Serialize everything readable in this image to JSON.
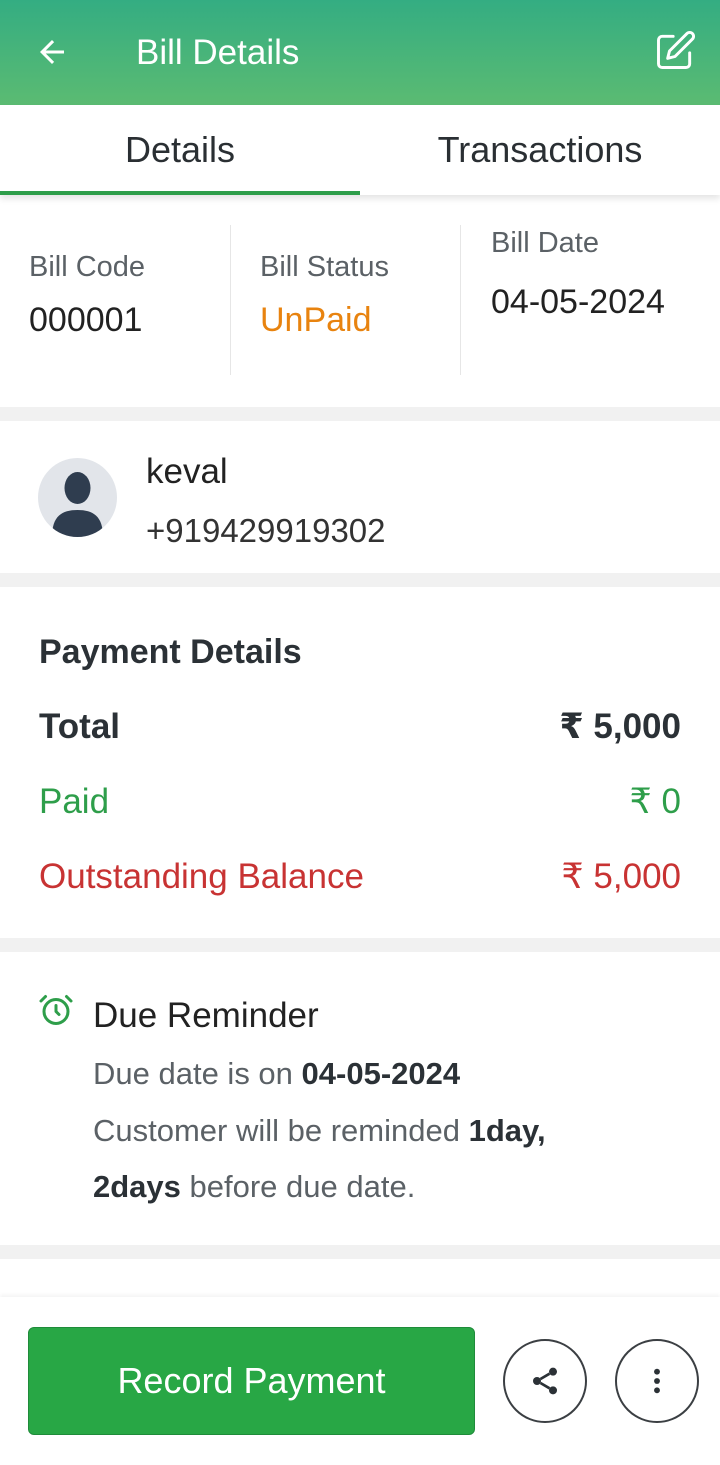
{
  "header": {
    "title": "Bill Details",
    "back_icon": "arrow-left-icon",
    "edit_icon": "edit-icon"
  },
  "tabs": [
    {
      "label": "Details",
      "active": true
    },
    {
      "label": "Transactions",
      "active": false
    }
  ],
  "bill": {
    "code_label": "Bill Code",
    "code_value": "000001",
    "status_label": "Bill Status",
    "status_value": "UnPaid",
    "date_label": "Bill Date",
    "date_value": "04-05-2024"
  },
  "customer": {
    "name": "keval",
    "phone": "+919429919302"
  },
  "payment": {
    "title": "Payment Details",
    "total_label": "Total",
    "total_value": "₹ 5,000",
    "paid_label": "Paid",
    "paid_value": "₹ 0",
    "outstanding_label": "Outstanding Balance",
    "outstanding_value": "₹ 5,000"
  },
  "reminder": {
    "title": "Due Reminder",
    "line1_prefix": "Due date is on ",
    "line1_date": "04-05-2024",
    "line2_prefix": "Customer will be reminded ",
    "line2_bold": "1day,",
    "line3_bold": "2days",
    "line3_suffix": " before due date."
  },
  "footer": {
    "record_label": "Record Payment",
    "share_icon": "share-icon",
    "more_icon": "more-vertical-icon"
  },
  "colors": {
    "header_gradient_start": "#34ad82",
    "header_gradient_end": "#5bbb72",
    "accent_green": "#28a745",
    "unpaid_orange": "#e8830f",
    "outstanding_red": "#c83333"
  }
}
